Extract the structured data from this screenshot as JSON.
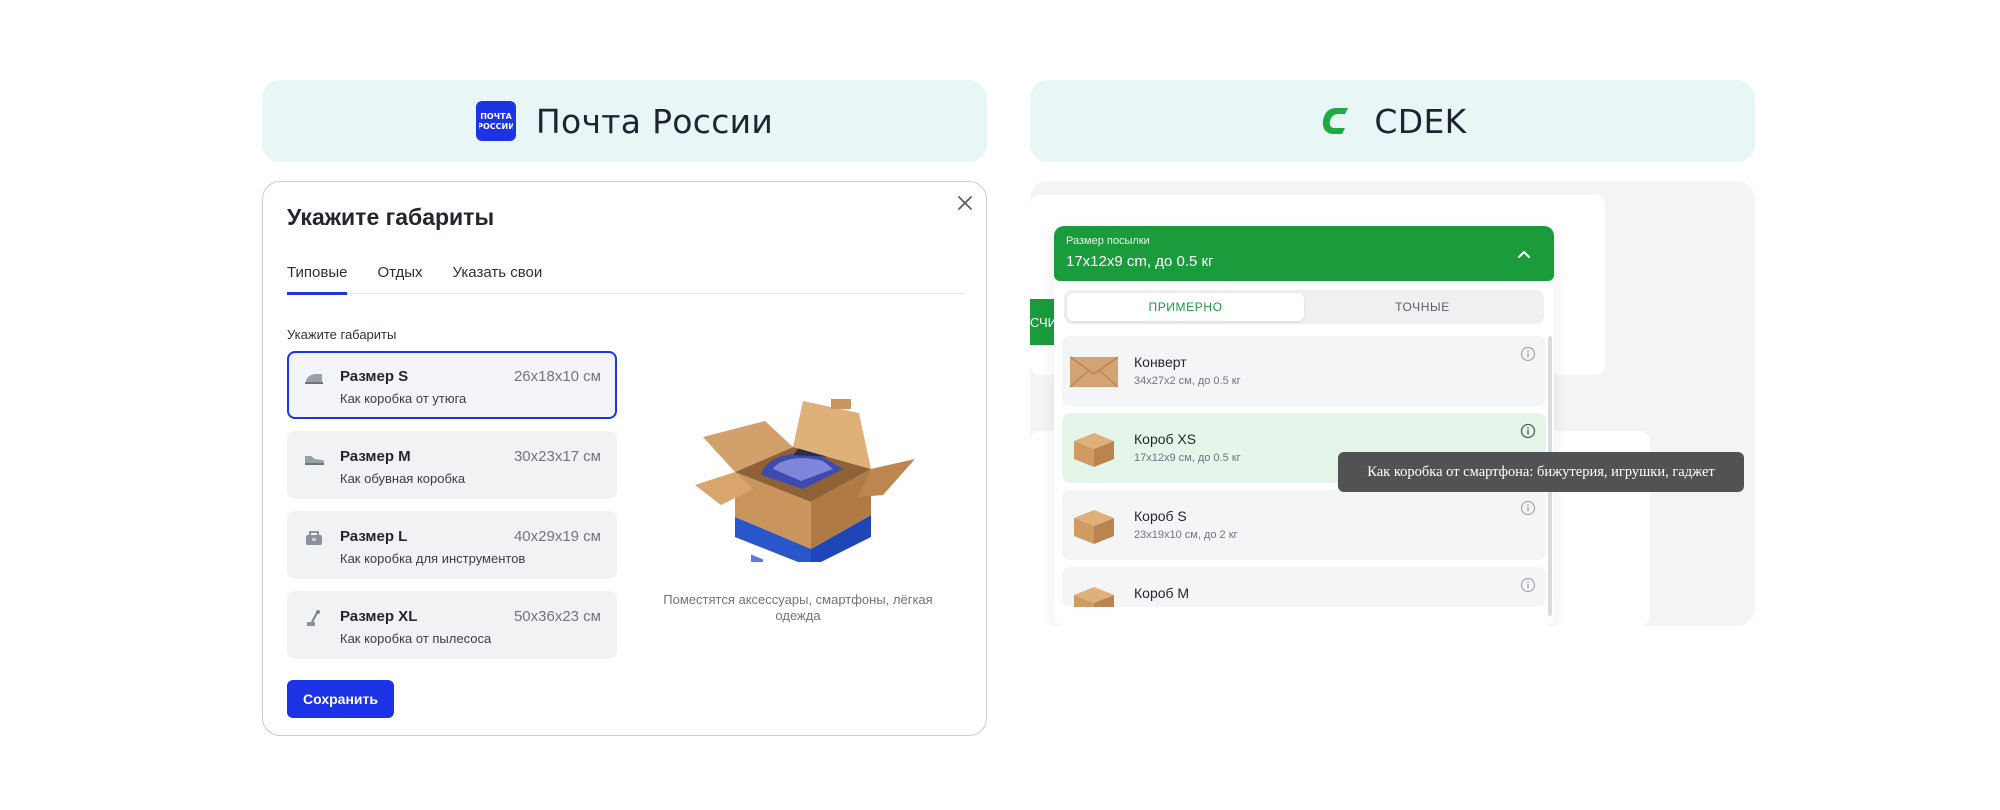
{
  "left": {
    "brand_name": "Почта России",
    "logo_text": [
      "ПОЧТА",
      "РОССИИ"
    ],
    "dialog": {
      "title": "Укажите габариты",
      "tabs": [
        {
          "label": "Типовые",
          "active": true
        },
        {
          "label": "Отдых",
          "active": false
        },
        {
          "label": "Указать свои",
          "active": false
        }
      ],
      "sublabel": "Укажите габариты",
      "sizes": [
        {
          "name": "Размер S",
          "dim": "26x18x10 см",
          "desc": "Как коробка от утюга",
          "icon": "iron-icon",
          "selected": true
        },
        {
          "name": "Размер M",
          "dim": "30x23x17 см",
          "desc": "Как обувная коробка",
          "icon": "shoe-icon",
          "selected": false
        },
        {
          "name": "Размер L",
          "dim": "40x29x19 см",
          "desc": "Как коробка для инструментов",
          "icon": "toolbox-icon",
          "selected": false
        },
        {
          "name": "Размер XL",
          "dim": "50x36x23 см",
          "desc": "Как коробка от пылесоса",
          "icon": "vacuum-icon",
          "selected": false
        }
      ],
      "hint": "Поместятся аксессуары, смартфоны, лёгкая одежда",
      "save_label": "Сохранить"
    }
  },
  "right": {
    "brand_name": "CDEK",
    "stub_text": "СЧИ",
    "dropdown": {
      "label": "Размер посылки",
      "value": "17x12x9 cm, до 0.5 кг",
      "segments": [
        {
          "label": "ПРИМЕРНО",
          "active": true
        },
        {
          "label": "ТОЧНЫЕ",
          "active": false
        }
      ],
      "items": [
        {
          "name": "Конверт",
          "dim": "34x27x2 см, до 0.5 кг",
          "icon": "envelope-icon",
          "highlight": false
        },
        {
          "name": "Короб XS",
          "dim": "17x12x9 см, до 0.5 кг",
          "icon": "box-icon",
          "highlight": true
        },
        {
          "name": "Короб S",
          "dim": "23x19x10 см, до 2 кг",
          "icon": "box-icon",
          "highlight": false
        },
        {
          "name": "Короб M",
          "dim": "",
          "icon": "box-icon",
          "highlight": false
        }
      ]
    },
    "tooltip": "Как коробка от смартфона: бижутерия, игрушки, гаджет"
  },
  "colors": {
    "pr_blue": "#1c33e6",
    "cdek_green": "#1a9c3c",
    "header_bg": "#e8f6f6"
  }
}
